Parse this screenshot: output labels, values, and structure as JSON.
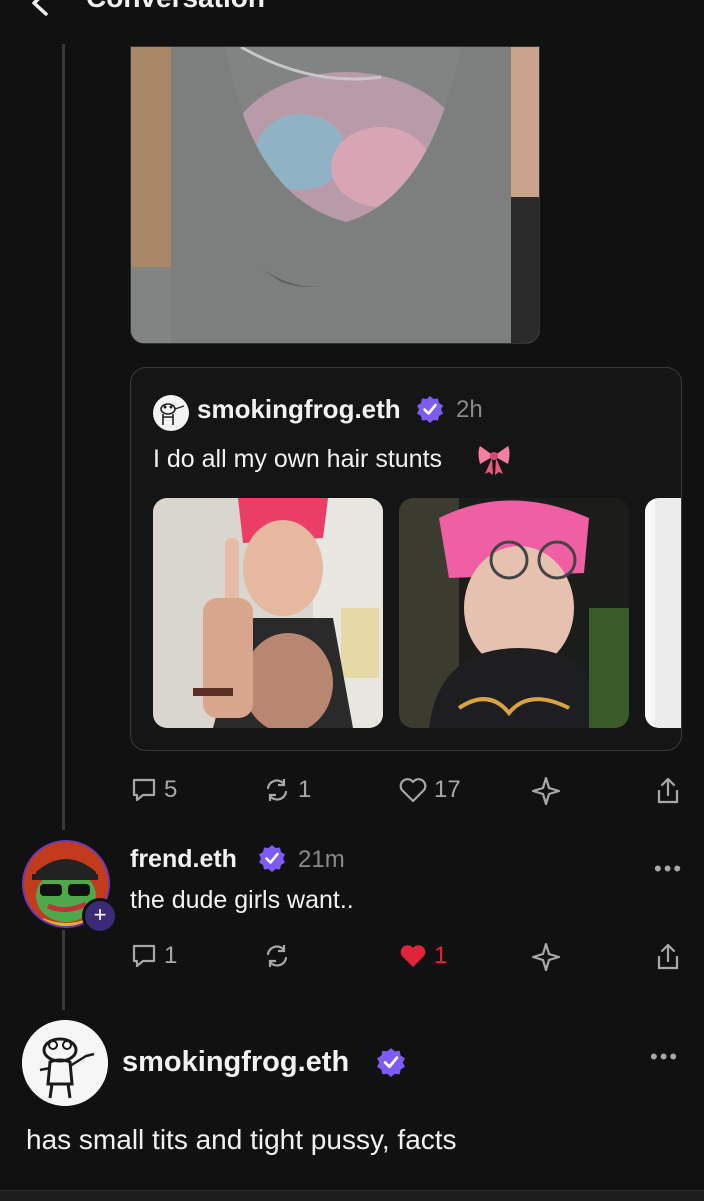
{
  "header": {
    "title": "Conversation"
  },
  "quote": {
    "author": "smokingfrog.eth",
    "time": "2h",
    "text": "I do all my own hair stunts",
    "emoji": "ribbon-emoji"
  },
  "post_actions": {
    "replies": "5",
    "recasts": "1",
    "likes": "17"
  },
  "reply": {
    "author": "frend.eth",
    "time": "21m",
    "text": "the dude girls want..",
    "replies": "1",
    "likes": "1",
    "more": "•••"
  },
  "main_post": {
    "author": "smokingfrog.eth",
    "text": "has small tits and tight pussy, facts",
    "more": "•••"
  },
  "colors": {
    "background": "#111111",
    "verified": "#7c5cf5",
    "like_active": "#e0243a",
    "muted": "#8a8a8a"
  }
}
